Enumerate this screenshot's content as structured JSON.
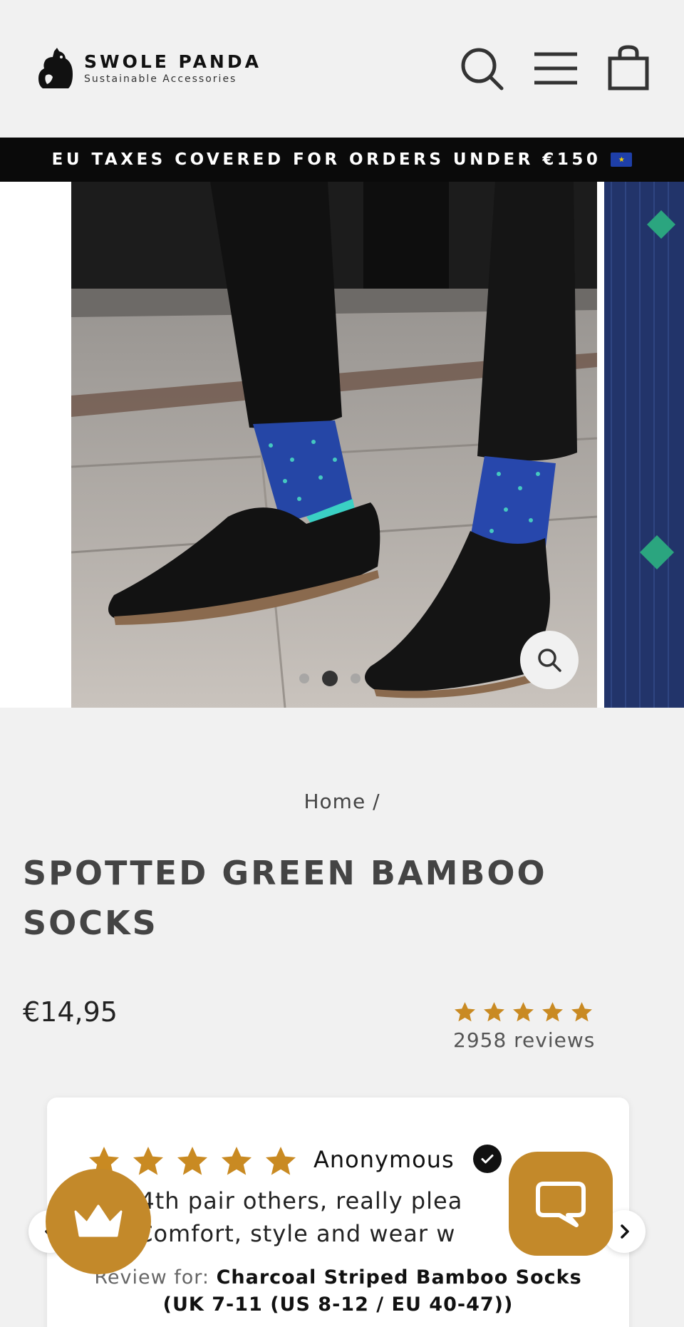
{
  "header": {
    "brand_name": "SWOLE PANDA",
    "brand_tagline": "Sustainable Accessories",
    "icons": [
      "search-icon",
      "menu-icon",
      "cart-icon"
    ]
  },
  "announcement": {
    "text": "EU TAXES COVERED FOR ORDERS UNDER €150",
    "flag_icon": "eu-flag-icon"
  },
  "gallery": {
    "slide_count": 3,
    "active_slide": 2
  },
  "product": {
    "breadcrumb": "Home /",
    "title": "Spotted Green Bamboo Socks",
    "price": "€14,95",
    "rating_stars": 5,
    "review_count": "2958 reviews"
  },
  "review": {
    "stars": 5,
    "author": "Anonymous",
    "body_line1": "d or 4th pair others, really plea",
    "body_line2": "ain. Comfort, style and wear w",
    "for_label": "Review for:",
    "for_product": "Charcoal Striped Bamboo Socks",
    "for_variant": "(UK 7-11 (US 8-12 / EU 40-47))"
  },
  "colors": {
    "accent": "#c3892a",
    "star": "#c98a22",
    "announcement_bg": "#0a0a0a",
    "page_bg": "#f1f1f1"
  }
}
